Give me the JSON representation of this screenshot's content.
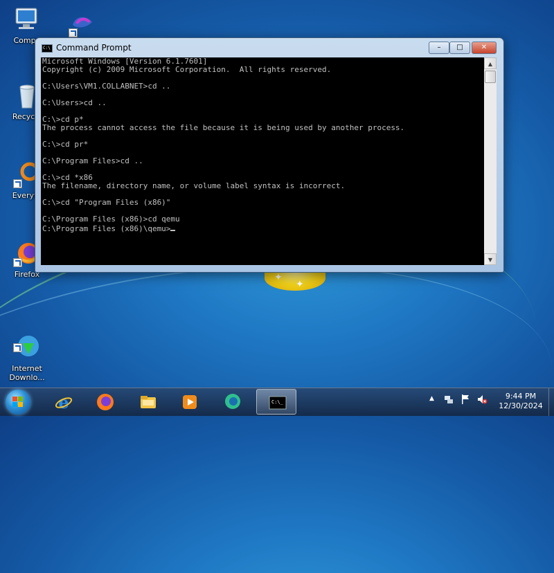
{
  "desktop": {
    "icons": [
      {
        "label": "Compu",
        "icon": "computer-icon"
      },
      {
        "label": "",
        "icon": "teamviewer-like-shortcut-icon"
      },
      {
        "label": "Recycle",
        "icon": "recycle-bin-icon"
      },
      {
        "label": "Everyth",
        "icon": "everything-search-icon"
      },
      {
        "label": "Firefox",
        "icon": "firefox-icon"
      },
      {
        "label": "Internet\nDownlo...",
        "icon": "internet-download-manager-icon"
      }
    ]
  },
  "window": {
    "title": "Command Prompt",
    "buttons": {
      "minimize": "–",
      "maximize": "□",
      "close": "✕"
    },
    "console_lines": [
      "Microsoft Windows [Version 6.1.7601]",
      "Copyright (c) 2009 Microsoft Corporation.  All rights reserved.",
      "",
      "C:\\Users\\VM1.COLLABNET>cd ..",
      "",
      "C:\\Users>cd ..",
      "",
      "C:\\>cd p*",
      "The process cannot access the file because it is being used by another process.",
      "",
      "C:\\>cd pr*",
      "",
      "C:\\Program Files>cd ..",
      "",
      "C:\\>cd *x86",
      "The filename, directory name, or volume label syntax is incorrect.",
      "",
      "C:\\>cd \"Program Files (x86)\"",
      "",
      "C:\\Program Files (x86)>cd qemu",
      ""
    ],
    "prompt": "C:\\Program Files (x86)\\qemu>"
  },
  "taskbar": {
    "pinned": [
      {
        "name": "internet-explorer",
        "icon": "internet-explorer-icon",
        "active": false
      },
      {
        "name": "firefox",
        "icon": "firefox-icon",
        "active": false
      },
      {
        "name": "explorer",
        "icon": "folder-icon",
        "active": false
      },
      {
        "name": "media-player",
        "icon": "media-player-icon",
        "active": false
      },
      {
        "name": "chat-app",
        "icon": "chat-bubble-icon",
        "active": false
      },
      {
        "name": "command-prompt",
        "icon": "cmd-icon",
        "active": true
      }
    ],
    "tray": {
      "time": "9:44 PM",
      "date": "12/30/2024"
    }
  },
  "colors": {
    "console_bg": "#000000",
    "console_fg": "#c0c0c0",
    "close_button": "#c7442e"
  }
}
